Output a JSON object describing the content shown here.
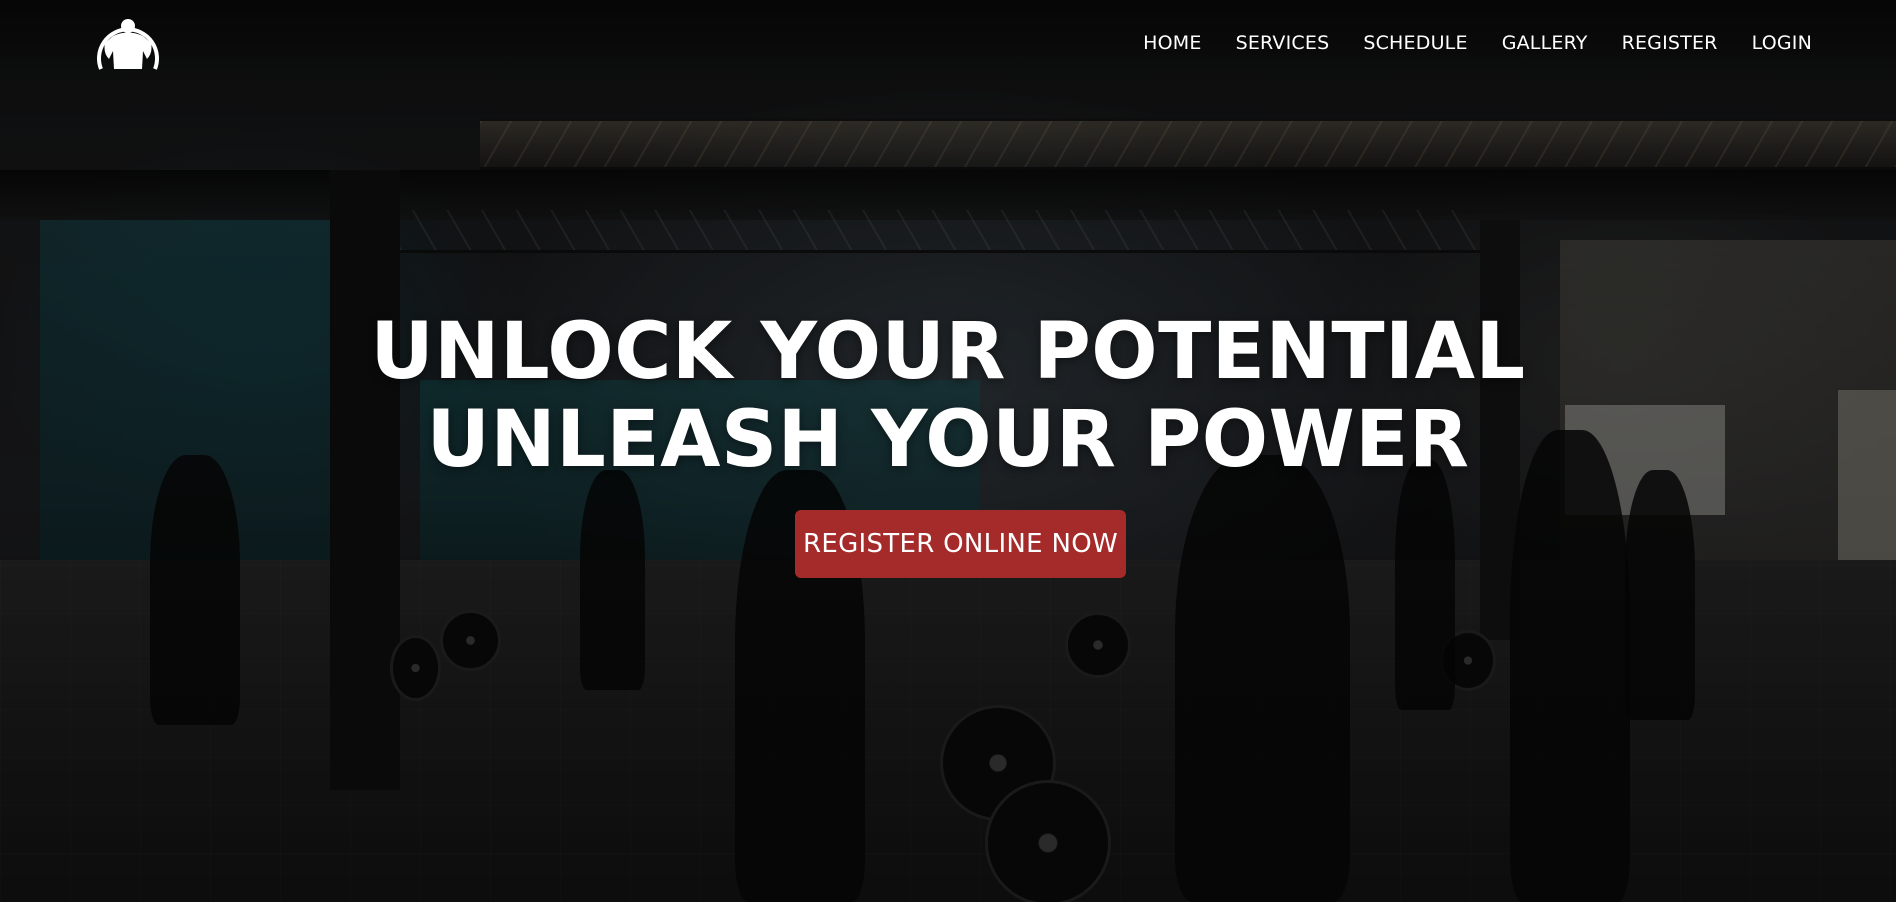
{
  "brand": {
    "logo_icon": "bodybuilder-logo-icon",
    "accent_color": "#a52a2a"
  },
  "nav": {
    "items": [
      {
        "label": "HOME"
      },
      {
        "label": "SERVICES"
      },
      {
        "label": "SCHEDULE"
      },
      {
        "label": "GALLERY"
      },
      {
        "label": "REGISTER"
      },
      {
        "label": "LOGIN"
      }
    ]
  },
  "hero": {
    "headline_line1": "UNLOCK YOUR POTENTIAL",
    "headline_line2": "UNLEASH YOUR POWER",
    "cta_label": "REGISTER ONLINE NOW",
    "background": "gym-interior-photo"
  }
}
